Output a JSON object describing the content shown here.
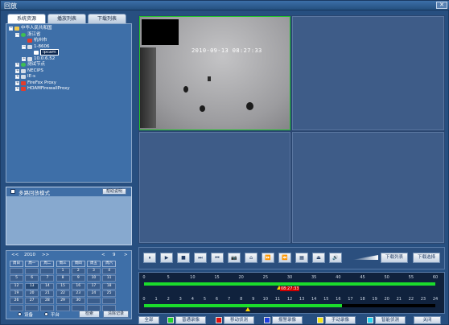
{
  "window": {
    "title": "回放",
    "close_label": "✕"
  },
  "left": {
    "tabs": [
      "系统资源",
      "播放列表",
      "下载列表"
    ],
    "tree": [
      {
        "indent": 0,
        "exp": "−",
        "icon": "folder",
        "label": "中华人民共和国"
      },
      {
        "indent": 1,
        "exp": "−",
        "icon": "globe",
        "label": "浙江省"
      },
      {
        "indent": 2,
        "exp": "",
        "icon": "cam-red",
        "label": "杭州市"
      },
      {
        "indent": 2,
        "exp": "−",
        "icon": "device",
        "label": "1-8606"
      },
      {
        "indent": 3,
        "exp": "",
        "icon": "cam",
        "label": "ipcam",
        "selected": true
      },
      {
        "indent": 2,
        "exp": "+",
        "icon": "device",
        "label": "10.0.6.52"
      },
      {
        "indent": 1,
        "exp": "+",
        "icon": "globe",
        "label": "测试节点"
      },
      {
        "indent": 1,
        "exp": "+",
        "icon": "device",
        "label": "NECIPS"
      },
      {
        "indent": 1,
        "exp": "+",
        "icon": "device",
        "label": "IE-s"
      },
      {
        "indent": 1,
        "exp": "+",
        "icon": "cam-red",
        "label": "FireFox Proxy"
      },
      {
        "indent": 1,
        "exp": "+",
        "icon": "cam-red",
        "label": "HOAMFirewallProxy"
      }
    ],
    "multi": {
      "label": "多路回放模式",
      "button": "帮助说明"
    },
    "calendar": {
      "prev_year": "<<",
      "year": "2010",
      "next_year": ">>",
      "prev_month": "<",
      "month": "9",
      "next_month": ">",
      "weekdays": [
        "周日",
        "周一",
        "周二",
        "周三",
        "周四",
        "周五",
        "周六"
      ],
      "weeks": [
        [
          "",
          "",
          "",
          "1",
          "2",
          "3",
          "4"
        ],
        [
          "5",
          "6",
          "7",
          "8",
          "9",
          "10",
          "11"
        ],
        [
          "12",
          "13",
          "14",
          "15",
          "16",
          "17",
          "18"
        ],
        [
          "19",
          "20",
          "21",
          "22",
          "23",
          "24",
          "25"
        ],
        [
          "26",
          "27",
          "28",
          "29",
          "30",
          "",
          ""
        ],
        [
          "",
          "",
          "",
          "",
          "",
          "",
          ""
        ]
      ],
      "radio1": "设备",
      "radio2": "平台",
      "btn1": "检索",
      "btn2": "清除记录"
    }
  },
  "video": {
    "timestamp": "2010-09-13 08:27:33"
  },
  "toolbar": {
    "buttons": [
      "⏸",
      "▶",
      "■",
      "⏭",
      "⏮",
      "📷",
      "⌂",
      "⏩",
      "⏪",
      "▦",
      "⏏",
      "🔊"
    ],
    "btn_r1": "下载列表",
    "btn_r2": "下载选择"
  },
  "timeline": {
    "top_ticks": [
      "0",
      "5",
      "10",
      "15",
      "20",
      "25",
      "30",
      "35",
      "40",
      "45",
      "50",
      "55",
      "60"
    ],
    "bottom_ticks": [
      "0",
      "1",
      "2",
      "3",
      "4",
      "5",
      "6",
      "7",
      "8",
      "9",
      "10",
      "11",
      "12",
      "13",
      "14",
      "15",
      "16",
      "17",
      "18",
      "19",
      "20",
      "21",
      "22",
      "23",
      "24"
    ],
    "current_time": "08:27:33",
    "top_fill": 1.0,
    "bottom_fill_start": 0.0,
    "bottom_fill_end": 0.68
  },
  "legend": {
    "all": "全部",
    "items": [
      {
        "label": "普通录像",
        "color": "#21d02f"
      },
      {
        "label": "移动侦测",
        "color": "#e01010"
      },
      {
        "label": "报警录像",
        "color": "#1f3fe0"
      },
      {
        "label": "手动录像",
        "color": "#f2e51c"
      },
      {
        "label": "智能侦测",
        "color": "#27d7f0"
      }
    ],
    "close": "关闭"
  }
}
